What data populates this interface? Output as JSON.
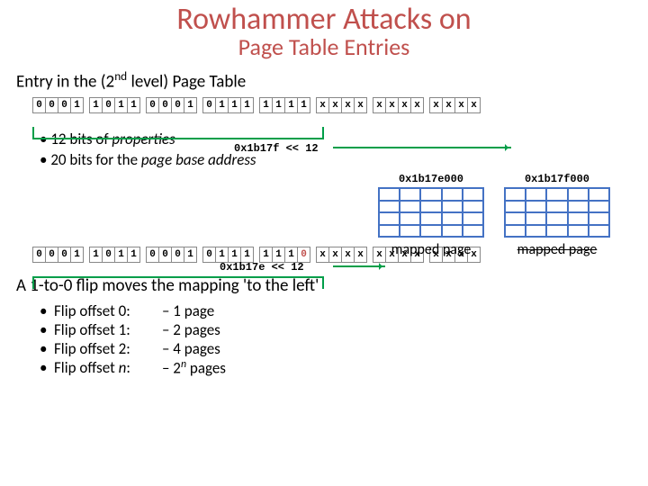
{
  "title": "Rowhammer Attacks on",
  "subtitle": "Page Table Entries",
  "heading1": "Entry in the (2",
  "heading1_sup": "nd",
  "heading1_rest": " level) Page Table",
  "row1": {
    "n0": [
      "0",
      "0",
      "0",
      "1"
    ],
    "n1": [
      "1",
      "0",
      "1",
      "1"
    ],
    "n2": [
      "0",
      "0",
      "0",
      "1"
    ],
    "n3": [
      "0",
      "1",
      "1",
      "1"
    ],
    "n4": [
      "1",
      "1",
      "1",
      "1"
    ],
    "n5": [
      "x",
      "x",
      "x",
      "x"
    ],
    "n6": [
      "x",
      "x",
      "x",
      "x"
    ],
    "n7": [
      "x",
      "x",
      "x",
      "x"
    ]
  },
  "label_top": "0x1b17f << 12",
  "bullets": {
    "b1a": "12 bits of ",
    "b1b": "properties",
    "b2a": "20 bits for the ",
    "b2b": "page base address"
  },
  "page_left": {
    "label": "0x1b17e000",
    "caption": "mapped page"
  },
  "page_right": {
    "label": "0x1b17f000",
    "caption": "mapped page"
  },
  "label_bottom": "0x1b17e << 12",
  "row2": {
    "n0": [
      "0",
      "0",
      "0",
      "1"
    ],
    "n1": [
      "1",
      "0",
      "1",
      "1"
    ],
    "n2": [
      "0",
      "0",
      "0",
      "1"
    ],
    "n3": [
      "0",
      "1",
      "1",
      "1"
    ],
    "n4": [
      "1",
      "1",
      "1",
      "0"
    ],
    "n5": [
      "x",
      "x",
      "x",
      "x"
    ],
    "n6": [
      "x",
      "x",
      "x",
      "x"
    ],
    "n7": [
      "x",
      "x",
      "x",
      "x"
    ]
  },
  "heading2": "A 1-to-0 flip moves the mapping 'to the left'",
  "flips": {
    "r0": {
      "l": "Flip offset 0:",
      "d": "– 1 page"
    },
    "r1": {
      "l": "Flip offset 1:",
      "d": "– 2 pages"
    },
    "r2": {
      "l": "Flip offset 2:",
      "d": "– 4 pages"
    },
    "r3l": "Flip offset ",
    "r3i": "n",
    "r3c": ":",
    "r3d1": "– 2",
    "r3sup": "n",
    "r3d2": " pages"
  }
}
